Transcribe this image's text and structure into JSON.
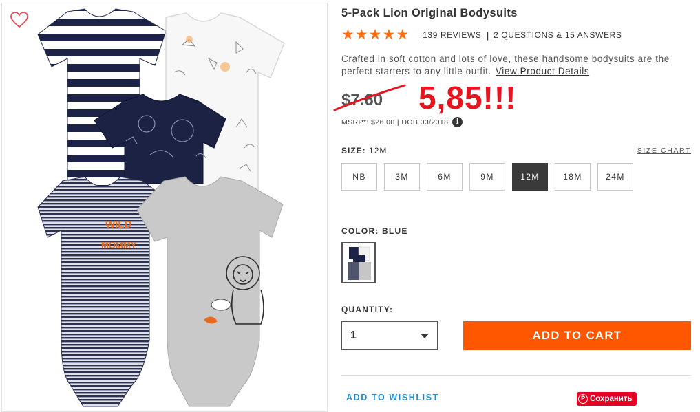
{
  "product": {
    "title": "5-Pack Lion Original Bodysuits",
    "rating_stars": 5,
    "reviews_label": "139 REVIEWS",
    "separator": "|",
    "qa_label": "2 QUESTIONS &  15 ANSWERS",
    "description": "Crafted in soft cotton and lots of love, these handsome bodysuits are the perfect starters to any little outfit.",
    "details_link": "View Product Details"
  },
  "price": {
    "old_price": "$7.60",
    "handwritten_new_price": "5,85!!!",
    "msrp": "MSRP*: $26.00 | DOB 03/2018",
    "info_icon": "i"
  },
  "size": {
    "label": "SIZE:",
    "selected": "12M",
    "chart_link": "SIZE CHART",
    "options": [
      "NB",
      "3M",
      "6M",
      "9M",
      "12M",
      "18M",
      "24M"
    ]
  },
  "color": {
    "label": "COLOR: BLUE"
  },
  "quantity": {
    "label": "QUANTITY:",
    "value": "1"
  },
  "actions": {
    "add_to_cart": "ADD TO CART",
    "wishlist": "ADD TO WISHLIST",
    "pinterest_save": "Сохранить"
  },
  "colors": {
    "accent_orange": "#ff5700",
    "star_orange": "#ff6d13",
    "handwriting_red": "#e8141f",
    "link_blue": "#1b8fd2",
    "pinterest_red": "#e60023"
  }
}
